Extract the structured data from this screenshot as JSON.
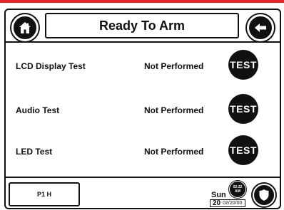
{
  "header": {
    "title": "Ready To Arm",
    "home_icon": "home-icon",
    "back_icon": "arrow-left-icon"
  },
  "tests": [
    {
      "label": "LCD Display Test",
      "status": "Not Performed",
      "button": "TEST"
    },
    {
      "label": "Audio Test",
      "status": "Not Performed",
      "button": "TEST"
    },
    {
      "label": "LED Test",
      "status": "Not Performed",
      "button": "TEST"
    }
  ],
  "footer": {
    "partition": "P1 H",
    "day": "Sun",
    "day_number": "20",
    "date": "02/20/00",
    "time": "02:22",
    "ampm": "AM",
    "shield_icon": "shield-icon"
  },
  "colors": {
    "accent_bar": "#e8232a",
    "button_fill": "#111111",
    "background": "#ffffff"
  }
}
